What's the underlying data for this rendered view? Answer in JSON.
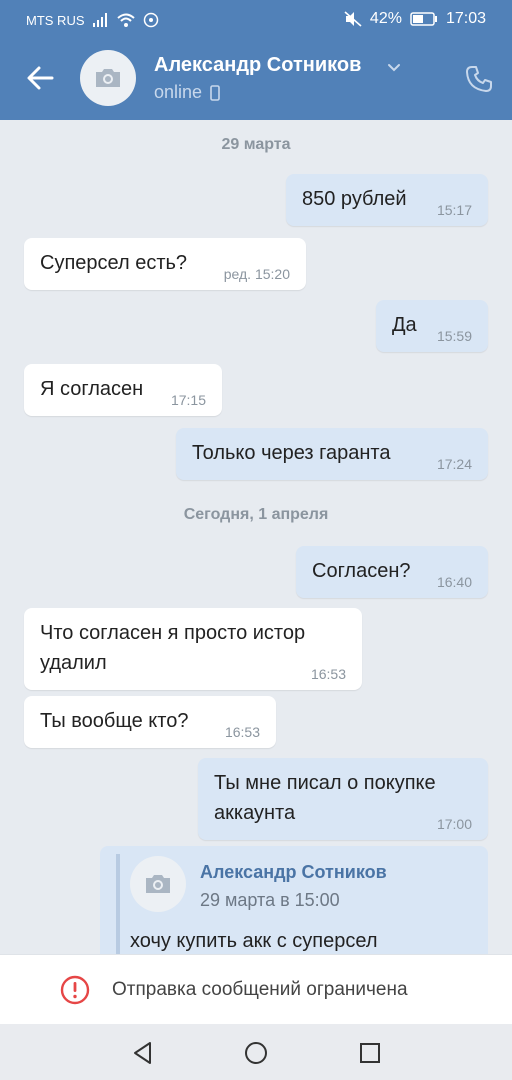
{
  "status_bar": {
    "carrier": "MTS RUS",
    "battery": "42%",
    "time": "17:03",
    "icons": [
      "signal-icon",
      "wifi-icon",
      "hotspot-icon",
      "mute-icon",
      "battery-icon"
    ]
  },
  "header": {
    "contact_name": "Александр Сотников",
    "status": "online",
    "icons": [
      "back-arrow-icon",
      "camera-icon",
      "chevron-down-icon",
      "mobile-icon",
      "phone-icon"
    ]
  },
  "dates": [
    "29 марта",
    "Сегодня, 1 апреля"
  ],
  "messages": [
    {
      "text": "850 рублей",
      "time": "15:17",
      "dir": "out"
    },
    {
      "text": "Суперсел есть?",
      "time": "ред. 15:20",
      "dir": "in"
    },
    {
      "text": "Да",
      "time": "15:59",
      "dir": "out"
    },
    {
      "text": "Я согласен",
      "time": "17:15",
      "dir": "in"
    },
    {
      "text": "Только через гаранта",
      "time": "17:24",
      "dir": "out"
    },
    {
      "text": "Согласен?",
      "time": "16:40",
      "dir": "out"
    },
    {
      "line1": "Что согласен я просто истор",
      "line2": "удалил",
      "time": "16:53",
      "dir": "in"
    },
    {
      "text": "Ты вообще кто?",
      "time": "16:53",
      "dir": "in"
    },
    {
      "line1": "Ты мне писал о покупке",
      "line2": "аккаунта",
      "time": "17:00",
      "dir": "out"
    }
  ],
  "forwarded": {
    "author": "Александр Сотников",
    "time": "29 марта в 15:00",
    "text": "хочу купить акк с суперсел"
  },
  "restriction": {
    "text": "Отправка сообщений ограничена"
  },
  "colors": {
    "header": "#5181b8",
    "background": "#e7ebf0",
    "incoming": "#ffffff",
    "outgoing": "#d9e6f5",
    "link": "#4a74a5",
    "warning": "#e64646"
  }
}
